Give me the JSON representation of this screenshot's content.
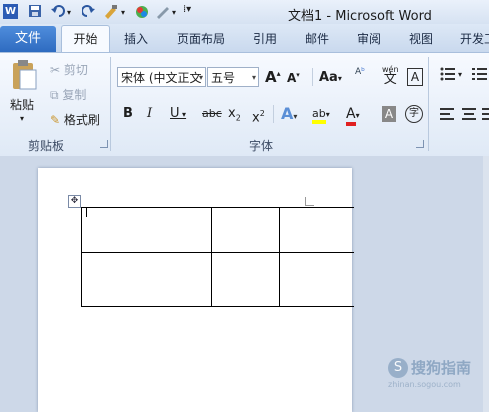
{
  "window": {
    "title": "文档1 - Microsoft Word",
    "app_icon": "word-icon"
  },
  "quick_access": {
    "items": [
      "save-icon",
      "undo-icon",
      "redo-icon",
      "format-painter-icon",
      "color-icon",
      "pen-icon",
      "customize-icon"
    ]
  },
  "tabs": [
    {
      "label": "文件"
    },
    {
      "label": "开始"
    },
    {
      "label": "插入"
    },
    {
      "label": "页面布局"
    },
    {
      "label": "引用"
    },
    {
      "label": "邮件"
    },
    {
      "label": "审阅"
    },
    {
      "label": "视图"
    },
    {
      "label": "开发工"
    }
  ],
  "clipboard": {
    "paste_label": "粘贴",
    "cut_label": "剪切",
    "copy_label": "复制",
    "format_painter_label": "格式刷",
    "group_label": "剪贴板"
  },
  "font": {
    "font_name": "宋体 (中文正文",
    "font_size": "五号",
    "group_label": "字体",
    "change_case_label": "Aa",
    "wen_label": "wén",
    "wen_char": "文",
    "border_char": "A",
    "encircle_char": "字"
  },
  "colors": {
    "accent": "#2e6bc0",
    "highlight": "#ffff00",
    "font_color": "#e02020"
  },
  "watermark": {
    "main": "搜狗指南",
    "sub": "zhinan.sogou.com"
  }
}
